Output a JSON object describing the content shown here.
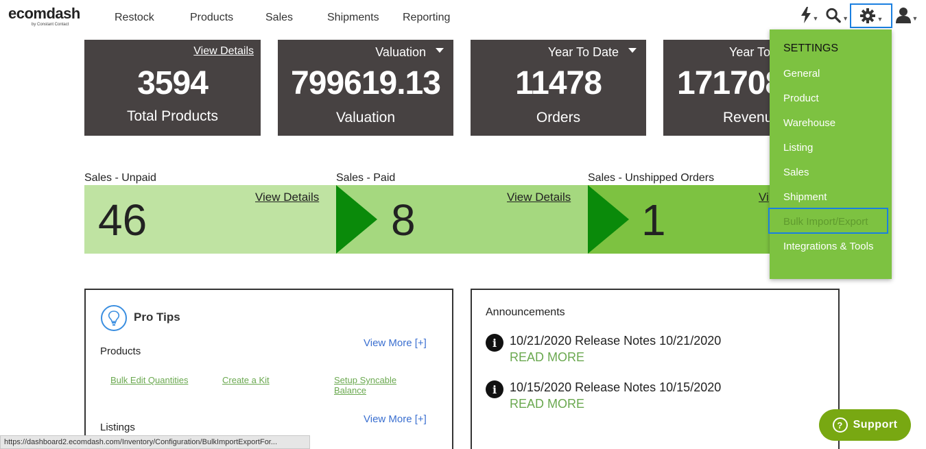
{
  "logo": {
    "brand": "ecomdash",
    "sub": "by Constant Contact"
  },
  "nav": {
    "links": [
      "Restock",
      "Products",
      "Sales",
      "Shipments",
      "Reporting"
    ]
  },
  "tiles": [
    {
      "value": "3594",
      "caption": "Total Products",
      "link": "View Details"
    },
    {
      "header": "Valuation",
      "value": "799619.13",
      "caption": "Valuation"
    },
    {
      "header": "Year To Date",
      "value": "11478",
      "caption": "Orders"
    },
    {
      "header": "Year To",
      "value": "171708",
      "caption": "Revenu"
    }
  ],
  "sales": [
    {
      "label": "Sales - Unpaid",
      "value": "46",
      "link": "View Details",
      "color": "#bfe3a2"
    },
    {
      "label": "Sales - Paid",
      "value": "8",
      "link": "View Details",
      "color": "#a5d87f"
    },
    {
      "label": "Sales - Unshipped Orders",
      "value": "1",
      "link": "Vi",
      "color": "#7dc241"
    }
  ],
  "pro_tips": {
    "title": "Pro Tips",
    "products_title": "Products",
    "listings_title": "Listings",
    "view_more": "View More [+]",
    "links": [
      "Bulk Edit Quantities",
      "Create a Kit",
      "Setup Syncable Balance"
    ]
  },
  "announcements": {
    "title": "Announcements",
    "items": [
      {
        "text": "10/21/2020 Release Notes 10/21/2020",
        "read_more": "READ MORE"
      },
      {
        "text": "10/15/2020 Release Notes 10/15/2020",
        "read_more": "READ MORE"
      }
    ]
  },
  "settings": {
    "title": "SETTINGS",
    "items": [
      "General",
      "Product",
      "Warehouse",
      "Listing",
      "Sales",
      "Shipment",
      "Bulk Import/Export",
      "Integrations & Tools"
    ],
    "active": "Bulk Import/Export"
  },
  "status_url": "https://dashboard2.ecomdash.com/Inventory/Configuration/BulkImportExportFor...",
  "support": {
    "label": "Support",
    "color": "#78a812"
  },
  "colors": {
    "tile": "#474242",
    "accent_green": "#7dc241",
    "highlight": "#1a7fe0",
    "arrow": "#0a8a0a"
  }
}
